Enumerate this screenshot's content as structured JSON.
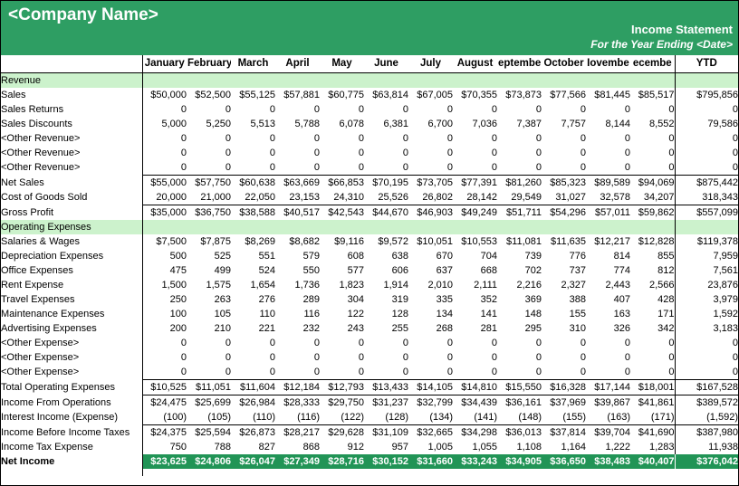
{
  "header": {
    "company_name": "<Company Name>",
    "statement_title": "Income Statement",
    "statement_period": "For the Year Ending <Date>"
  },
  "columns": {
    "label": "",
    "months": [
      "January",
      "February",
      "March",
      "April",
      "May",
      "June",
      "July",
      "August",
      "eptembe",
      "October",
      "Iovembe",
      "ecembe"
    ],
    "ytd": "YTD"
  },
  "chart_data": {
    "type": "table",
    "title": "Income Statement",
    "categories": [
      "January",
      "February",
      "March",
      "April",
      "May",
      "June",
      "July",
      "August",
      "September",
      "October",
      "November",
      "December",
      "YTD"
    ],
    "series": [
      {
        "name": "Sales",
        "values": [
          50000,
          52500,
          55125,
          57881,
          60775,
          63814,
          67005,
          70355,
          73873,
          77566,
          81445,
          85517,
          795856
        ]
      },
      {
        "name": "Sales Returns",
        "values": [
          0,
          0,
          0,
          0,
          0,
          0,
          0,
          0,
          0,
          0,
          0,
          0,
          0
        ]
      },
      {
        "name": "Sales Discounts",
        "values": [
          5000,
          5250,
          5513,
          5788,
          6078,
          6381,
          6700,
          7036,
          7387,
          7757,
          8144,
          8552,
          79586
        ]
      },
      {
        "name": "Net Sales",
        "values": [
          55000,
          57750,
          60638,
          63669,
          66853,
          70195,
          73705,
          77391,
          81260,
          85323,
          89589,
          94069,
          875442
        ]
      },
      {
        "name": "Cost of Goods Sold",
        "values": [
          20000,
          21000,
          22050,
          23153,
          24310,
          25526,
          26802,
          28142,
          29549,
          31027,
          32578,
          34207,
          318343
        ]
      },
      {
        "name": "Gross Profit",
        "values": [
          35000,
          36750,
          38588,
          40517,
          42543,
          44670,
          46903,
          49249,
          51711,
          54296,
          57011,
          59862,
          557099
        ]
      },
      {
        "name": "Salaries & Wages",
        "values": [
          7500,
          7875,
          8269,
          8682,
          9116,
          9572,
          10051,
          10553,
          11081,
          11635,
          12217,
          12828,
          119378
        ]
      },
      {
        "name": "Depreciation Expenses",
        "values": [
          500,
          525,
          551,
          579,
          608,
          638,
          670,
          704,
          739,
          776,
          814,
          855,
          7959
        ]
      },
      {
        "name": "Office Expenses",
        "values": [
          475,
          499,
          524,
          550,
          577,
          606,
          637,
          668,
          702,
          737,
          774,
          812,
          7561
        ]
      },
      {
        "name": "Rent Expense",
        "values": [
          1500,
          1575,
          1654,
          1736,
          1823,
          1914,
          2010,
          2111,
          2216,
          2327,
          2443,
          2566,
          23876
        ]
      },
      {
        "name": "Travel Expenses",
        "values": [
          250,
          263,
          276,
          289,
          304,
          319,
          335,
          352,
          369,
          388,
          407,
          428,
          3979
        ]
      },
      {
        "name": "Maintenance Expenses",
        "values": [
          100,
          105,
          110,
          116,
          122,
          128,
          134,
          141,
          148,
          155,
          163,
          171,
          1592
        ]
      },
      {
        "name": "Advertising Expenses",
        "values": [
          200,
          210,
          221,
          232,
          243,
          255,
          268,
          281,
          295,
          310,
          326,
          342,
          3183
        ]
      },
      {
        "name": "Total Operating Expenses",
        "values": [
          10525,
          11051,
          11604,
          12184,
          12793,
          13433,
          14105,
          14810,
          15550,
          16328,
          17144,
          18001,
          167528
        ]
      },
      {
        "name": "Income From Operations",
        "values": [
          24475,
          25699,
          26984,
          28333,
          29750,
          31237,
          32799,
          34439,
          36161,
          37969,
          39867,
          41861,
          389572
        ]
      },
      {
        "name": "Interest Income (Expense)",
        "values": [
          -100,
          -105,
          -110,
          -116,
          -122,
          -128,
          -134,
          -141,
          -148,
          -155,
          -163,
          -171,
          -1592
        ]
      },
      {
        "name": "Income Before Income Taxes",
        "values": [
          24375,
          25594,
          26873,
          28217,
          29628,
          31109,
          32665,
          34298,
          36013,
          37814,
          39704,
          41690,
          387980
        ]
      },
      {
        "name": "Income Tax Expense",
        "values": [
          750,
          788,
          827,
          868,
          912,
          957,
          1005,
          1055,
          1108,
          1164,
          1222,
          1283,
          11938
        ]
      },
      {
        "name": "Net Income",
        "values": [
          23625,
          24806,
          26047,
          27349,
          28716,
          30152,
          31660,
          33243,
          34905,
          36650,
          38483,
          40407,
          376042
        ]
      }
    ]
  },
  "rows": [
    {
      "label": "Revenue",
      "style": "section",
      "values": [
        "",
        "",
        "",
        "",
        "",
        "",
        "",
        "",
        "",
        "",
        "",
        "",
        ""
      ]
    },
    {
      "label": "Sales",
      "style": "plain",
      "values": [
        "$50,000",
        "$52,500",
        "$55,125",
        "$57,881",
        "$60,775",
        "$63,814",
        "$67,005",
        "$70,355",
        "$73,873",
        "$77,566",
        "$81,445",
        "$85,517",
        "$795,856"
      ]
    },
    {
      "label": "Sales Returns",
      "style": "plain",
      "values": [
        "0",
        "0",
        "0",
        "0",
        "0",
        "0",
        "0",
        "0",
        "0",
        "0",
        "0",
        "0",
        "0"
      ]
    },
    {
      "label": "Sales Discounts",
      "style": "plain",
      "values": [
        "5,000",
        "5,250",
        "5,513",
        "5,788",
        "6,078",
        "6,381",
        "6,700",
        "7,036",
        "7,387",
        "7,757",
        "8,144",
        "8,552",
        "79,586"
      ]
    },
    {
      "label": "<Other Revenue>",
      "style": "plain",
      "values": [
        "0",
        "0",
        "0",
        "0",
        "0",
        "0",
        "0",
        "0",
        "0",
        "0",
        "0",
        "0",
        "0"
      ]
    },
    {
      "label": "<Other Revenue>",
      "style": "plain",
      "values": [
        "0",
        "0",
        "0",
        "0",
        "0",
        "0",
        "0",
        "0",
        "0",
        "0",
        "0",
        "0",
        "0"
      ]
    },
    {
      "label": "<Other Revenue>",
      "style": "plain",
      "values": [
        "0",
        "0",
        "0",
        "0",
        "0",
        "0",
        "0",
        "0",
        "0",
        "0",
        "0",
        "0",
        "0"
      ]
    },
    {
      "label": "Net Sales",
      "style": "rule-top",
      "values": [
        "$55,000",
        "$57,750",
        "$60,638",
        "$63,669",
        "$66,853",
        "$70,195",
        "$73,705",
        "$77,391",
        "$81,260",
        "$85,323",
        "$89,589",
        "$94,069",
        "$875,442"
      ]
    },
    {
      "label": "Cost of Goods Sold",
      "style": "rule-bot",
      "values": [
        "20,000",
        "21,000",
        "22,050",
        "23,153",
        "24,310",
        "25,526",
        "26,802",
        "28,142",
        "29,549",
        "31,027",
        "32,578",
        "34,207",
        "318,343"
      ]
    },
    {
      "label": "Gross Profit",
      "style": "plain",
      "values": [
        "$35,000",
        "$36,750",
        "$38,588",
        "$40,517",
        "$42,543",
        "$44,670",
        "$46,903",
        "$49,249",
        "$51,711",
        "$54,296",
        "$57,011",
        "$59,862",
        "$557,099"
      ]
    },
    {
      "label": "Operating Expenses",
      "style": "section",
      "values": [
        "",
        "",
        "",
        "",
        "",
        "",
        "",
        "",
        "",
        "",
        "",
        "",
        ""
      ]
    },
    {
      "label": "Salaries & Wages",
      "style": "plain",
      "values": [
        "$7,500",
        "$7,875",
        "$8,269",
        "$8,682",
        "$9,116",
        "$9,572",
        "$10,051",
        "$10,553",
        "$11,081",
        "$11,635",
        "$12,217",
        "$12,828",
        "$119,378"
      ]
    },
    {
      "label": "Depreciation Expenses",
      "style": "plain",
      "values": [
        "500",
        "525",
        "551",
        "579",
        "608",
        "638",
        "670",
        "704",
        "739",
        "776",
        "814",
        "855",
        "7,959"
      ]
    },
    {
      "label": "Office Expenses",
      "style": "plain",
      "values": [
        "475",
        "499",
        "524",
        "550",
        "577",
        "606",
        "637",
        "668",
        "702",
        "737",
        "774",
        "812",
        "7,561"
      ]
    },
    {
      "label": "Rent Expense",
      "style": "plain",
      "values": [
        "1,500",
        "1,575",
        "1,654",
        "1,736",
        "1,823",
        "1,914",
        "2,010",
        "2,111",
        "2,216",
        "2,327",
        "2,443",
        "2,566",
        "23,876"
      ]
    },
    {
      "label": "Travel Expenses",
      "style": "plain",
      "values": [
        "250",
        "263",
        "276",
        "289",
        "304",
        "319",
        "335",
        "352",
        "369",
        "388",
        "407",
        "428",
        "3,979"
      ]
    },
    {
      "label": "Maintenance Expenses",
      "style": "plain",
      "values": [
        "100",
        "105",
        "110",
        "116",
        "122",
        "128",
        "134",
        "141",
        "148",
        "155",
        "163",
        "171",
        "1,592"
      ]
    },
    {
      "label": "Advertising Expenses",
      "style": "plain",
      "values": [
        "200",
        "210",
        "221",
        "232",
        "243",
        "255",
        "268",
        "281",
        "295",
        "310",
        "326",
        "342",
        "3,183"
      ]
    },
    {
      "label": "<Other Expense>",
      "style": "plain",
      "values": [
        "0",
        "0",
        "0",
        "0",
        "0",
        "0",
        "0",
        "0",
        "0",
        "0",
        "0",
        "0",
        "0"
      ]
    },
    {
      "label": "<Other Expense>",
      "style": "plain",
      "values": [
        "0",
        "0",
        "0",
        "0",
        "0",
        "0",
        "0",
        "0",
        "0",
        "0",
        "0",
        "0",
        "0"
      ]
    },
    {
      "label": "<Other Expense>",
      "style": "plain",
      "values": [
        "0",
        "0",
        "0",
        "0",
        "0",
        "0",
        "0",
        "0",
        "0",
        "0",
        "0",
        "0",
        "0"
      ]
    },
    {
      "label": "Total Operating Expenses",
      "style": "rule-top",
      "values": [
        "$10,525",
        "$11,051",
        "$11,604",
        "$12,184",
        "$12,793",
        "$13,433",
        "$14,105",
        "$14,810",
        "$15,550",
        "$16,328",
        "$17,144",
        "$18,001",
        "$167,528"
      ]
    },
    {
      "label": "Income From Operations",
      "style": "rule-top",
      "values": [
        "$24,475",
        "$25,699",
        "$26,984",
        "$28,333",
        "$29,750",
        "$31,237",
        "$32,799",
        "$34,439",
        "$36,161",
        "$37,969",
        "$39,867",
        "$41,861",
        "$389,572"
      ]
    },
    {
      "label": "Interest Income (Expense)",
      "style": "plain",
      "values": [
        "(100)",
        "(105)",
        "(110)",
        "(116)",
        "(122)",
        "(128)",
        "(134)",
        "(141)",
        "(148)",
        "(155)",
        "(163)",
        "(171)",
        "(1,592)"
      ]
    },
    {
      "label": "Income Before Income Taxes",
      "style": "rule-top",
      "values": [
        "$24,375",
        "$25,594",
        "$26,873",
        "$28,217",
        "$29,628",
        "$31,109",
        "$32,665",
        "$34,298",
        "$36,013",
        "$37,814",
        "$39,704",
        "$41,690",
        "$387,980"
      ]
    },
    {
      "label": "Income Tax Expense",
      "style": "plain",
      "values": [
        "750",
        "788",
        "827",
        "868",
        "912",
        "957",
        "1,005",
        "1,055",
        "1,108",
        "1,164",
        "1,222",
        "1,283",
        "11,938"
      ]
    },
    {
      "label": "Net Income",
      "style": "netincome",
      "values": [
        "$23,625",
        "$24,806",
        "$26,047",
        "$27,349",
        "$28,716",
        "$30,152",
        "$31,660",
        "$33,243",
        "$34,905",
        "$36,650",
        "$38,483",
        "$40,407",
        "$376,042"
      ]
    }
  ]
}
